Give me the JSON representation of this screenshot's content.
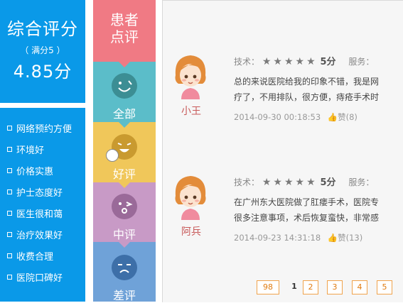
{
  "summary": {
    "title": "综合评分",
    "full_score": "（ 满分5 ）",
    "score": "4.85分"
  },
  "tags": [
    "网络预约方便",
    "环境好",
    "价格实惠",
    "护士态度好",
    "医生很和蔼",
    "治疗效果好",
    "收费合理",
    "医院口碑好"
  ],
  "filters": {
    "heading": "患者\n点评",
    "items": [
      {
        "label": "全部",
        "color": "#5bbdc9",
        "face_color": "#3c8e94"
      },
      {
        "label": "好评",
        "color": "#f0c75a",
        "face_color": "#c99a2f"
      },
      {
        "label": "中评",
        "color": "#c89ac6",
        "face_color": "#9a6a99"
      },
      {
        "label": "差评",
        "color": "#6fa2d8",
        "face_color": "#3d6fa8"
      }
    ],
    "heading_color": "#f07a84"
  },
  "reviews": [
    {
      "name": "小王",
      "tech_label": "技术：",
      "tech_score": "5分",
      "service_label": "服务：",
      "text_line1": "总的来说医院给我的印象不错，我是网",
      "text_line2": "疗了，不用排队，很方便，痔疮手术时",
      "datetime": "2014-09-30 00:18:53",
      "likes": "赞(8)"
    },
    {
      "name": "阿兵",
      "tech_label": "技术：",
      "tech_score": "5分",
      "service_label": "服务：",
      "text_line1": "在广州东大医院做了肛瘘手术，医院专",
      "text_line2": "很多注意事项，术后恢复蛮快，非常感",
      "datetime": "2014-09-23 14:31:18",
      "likes": "赞(13)"
    }
  ],
  "pagination": {
    "first": "98",
    "current": "1",
    "pages": [
      "2",
      "3",
      "4",
      "5"
    ]
  },
  "colors": {
    "accent": "#0a99e8",
    "page_border": "#f0a34c"
  }
}
